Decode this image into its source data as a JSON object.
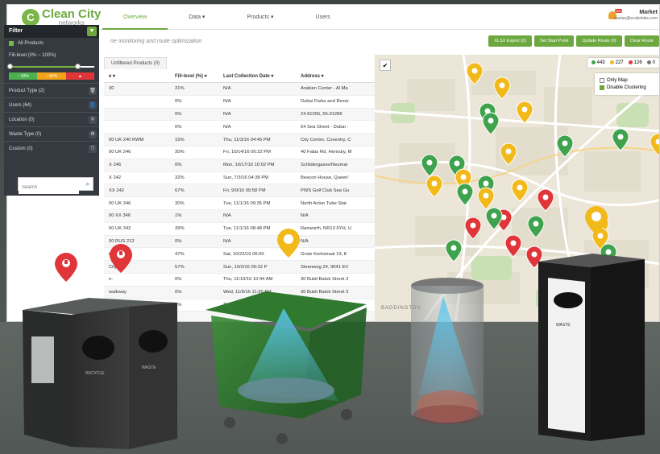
{
  "app": {
    "brand": "Clean City",
    "brand_sub": "networks",
    "nav": [
      "Overview",
      "Data ▾",
      "Products ▾",
      "Users"
    ],
    "user_name": "Market",
    "user_email": "marian@ecubelabs.com",
    "notification_badge": "new",
    "subtitle": "ne monitoring and route optimization"
  },
  "toolbar": [
    "XLSX Export (0)",
    "Set Start Point",
    "Update Route (0)",
    "Clear Route"
  ],
  "filter": {
    "title": "Filter",
    "all_products": "All Products",
    "fill_level_label": "Fill-level (0% ~ 100%)",
    "fill_level_value": 0.8,
    "legend": [
      "~ 30%",
      "~ 80%",
      "▲"
    ],
    "sections": [
      {
        "label": "Product Type (2)",
        "icon": "trash-icon",
        "glyph": "🗑"
      },
      {
        "label": "Users (64)",
        "icon": "user-icon",
        "glyph": "👤"
      },
      {
        "label": "Location (0)",
        "icon": "location-pin-icon",
        "glyph": "⚲"
      },
      {
        "label": "Waste Type (0)",
        "icon": "recycle-icon",
        "glyph": "♻"
      },
      {
        "label": "Custom (0)",
        "icon": "tag-icon",
        "glyph": "⛉"
      }
    ],
    "search_placeholder": "Search"
  },
  "tabs": [
    "Unfiltered Products (0)"
  ],
  "table": {
    "headers": [
      "e ▾",
      "Fill-level (%) ▾",
      "Last Collection Date ▾",
      "Address ▾"
    ],
    "rows": [
      [
        "30",
        "31%",
        "N/A",
        "Arabian Center - Al Ma"
      ],
      [
        "",
        "0%",
        "N/A",
        "Dubai Parks and Resor"
      ],
      [
        "",
        "0%",
        "N/A",
        "24.91055, 55.01286"
      ],
      [
        "",
        "0%",
        "N/A",
        "54 Sea Street - Dubai -"
      ],
      [
        "00 UK 240 RWM",
        "15%",
        "Thu, 11/3/16 04:45 PM",
        "City Centre, Coventry, C"
      ],
      [
        "00 UK 246",
        "30%",
        "Fri, 10/14/16 06:22 PM",
        "40 Falas Rd, Hemsby, M"
      ],
      [
        "X 246",
        "0%",
        "Mon, 10/17/16 10:02 PM",
        "Schildergasse/Neumar"
      ],
      [
        "X 242",
        "32%",
        "Sun, 7/3/16 04:38 PM",
        "Beacon House, Queen'"
      ],
      [
        "XX 242",
        "67%",
        "Fri, 9/9/16 09:58 PM",
        "PWS Golf Club Sea Gu"
      ],
      [
        "00 UK 346",
        "30%",
        "Tue, 11/1/16 09:35 PM",
        "North Acton Tube Stat"
      ],
      [
        "00 XX 346",
        "1%",
        "N/A",
        "N/A"
      ],
      [
        "00 UK 342",
        "39%",
        "Tue, 11/1/16 08:48 PM",
        "Ranworth, NR13 6YH, U"
      ],
      [
        "00 RUS 212",
        "0%",
        "N/A",
        "N/A"
      ],
      [
        "ty",
        "47%",
        "Sat, 10/22/16 06:00",
        "Grote Kerkstraat 19, 8"
      ],
      [
        "City",
        "57%",
        "Sun, 10/2/16 05:32 P",
        "Steenweg 24, 9041 EV"
      ],
      [
        "n-",
        "0%",
        "Thu, 11/10/16 10:44 AM",
        "30 Bukit Batok Street 3"
      ],
      [
        "walkway",
        "0%",
        "Wed, 11/9/16 11:26 AM",
        "30 Bukit Batok Street 3"
      ],
      [
        "0 120L New",
        "2%",
        "Thu, 11/9/16 04:26 PM",
        "541 Bukit Batok Street"
      ],
      [
        "",
        "",
        "",
        ""
      ]
    ]
  },
  "map": {
    "counts": {
      "green": "443",
      "yellow": "227",
      "red": "126",
      "gray": "0"
    },
    "options": [
      "Only Map",
      "Disable Clustering"
    ],
    "place": "BADDINGTON"
  },
  "products_labels": [
    "RECYCLE",
    "WASTE"
  ],
  "colors": {
    "brand": "#6da83f",
    "green": "#3fa34d",
    "yellow": "#f2b91b",
    "red": "#e0363a"
  }
}
